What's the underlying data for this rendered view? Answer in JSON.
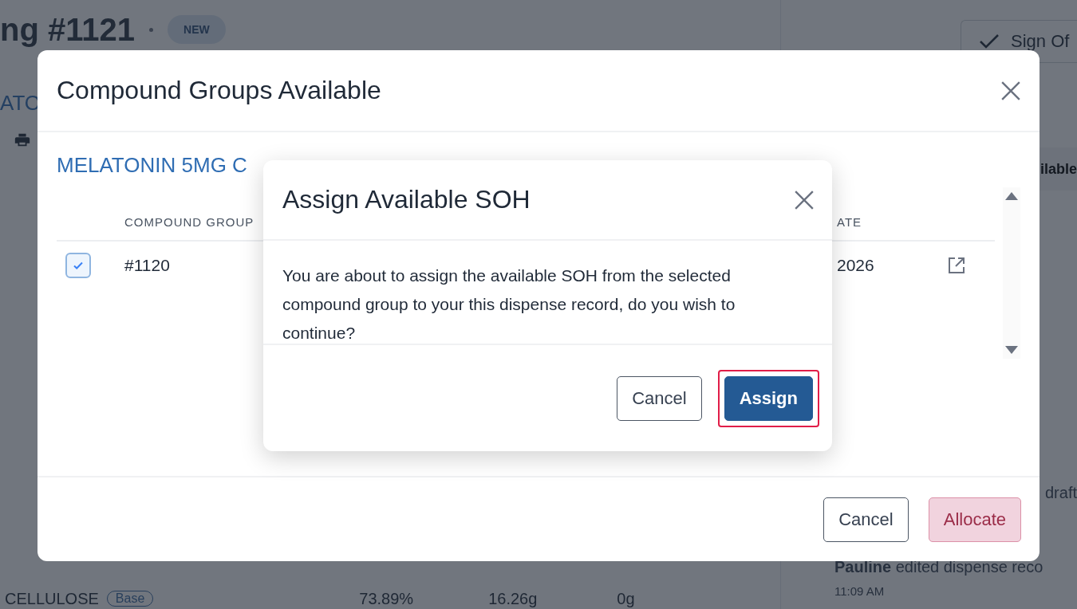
{
  "page": {
    "title": "ng #1121",
    "status_badge": "NEW",
    "sign_off_button": "Sign Of",
    "section_label": "ATO",
    "side_tab": "ilable",
    "activity": [
      {
        "text": "draft"
      },
      {
        "text": "**Pauline** edited dispense reco",
        "time": "11:09 AM"
      }
    ],
    "ingredient_row": {
      "name": "CELLULOSE",
      "tag": "Base",
      "cells": [
        "73.89%",
        "16.26g",
        "0g"
      ]
    }
  },
  "compound_groups_dialog": {
    "title": "Compound Groups Available",
    "product": "MELATONIN 5MG C",
    "columns": [
      "COMPOUND GROUP",
      "ATE"
    ],
    "rows": [
      {
        "checked": true,
        "group": "#1120",
        "date": "2026"
      }
    ],
    "buttons": [
      {
        "label": "Cancel",
        "kind": "secondary"
      },
      {
        "label": "Allocate",
        "kind": "danger"
      }
    ]
  },
  "assign_dialog": {
    "title": "Assign Available SOH",
    "message": "You are about to assign the available SOH from the selected compound group to your this dispense record, do you wish to continue?",
    "buttons": [
      {
        "label": "Cancel",
        "kind": "secondary",
        "focused": false
      },
      {
        "label": "Assign",
        "kind": "primary",
        "focused": true
      }
    ]
  }
}
